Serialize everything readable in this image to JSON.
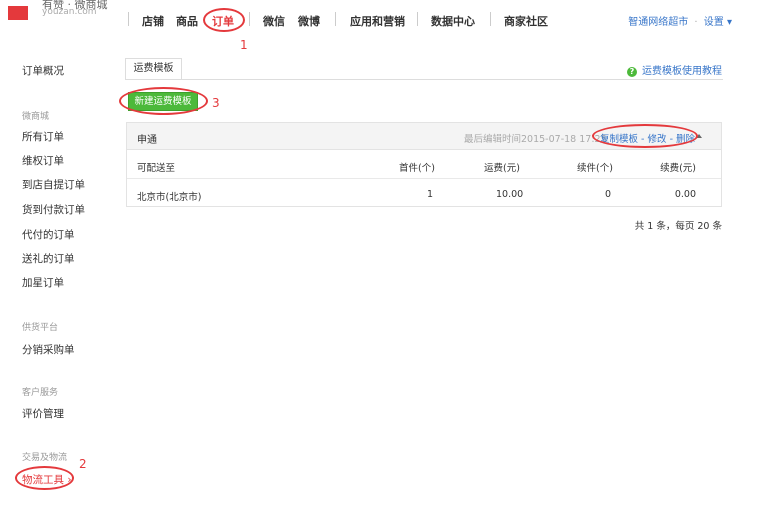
{
  "brand": {
    "title": "有赞 · 微商城",
    "subtitle": "youzan.com"
  },
  "nav": {
    "items": [
      "店铺",
      "商品",
      "订单",
      "微信",
      "微博",
      "应用和营销",
      "数据中心",
      "商家社区"
    ],
    "active": "订单"
  },
  "top_right": {
    "store": "智通网络超市",
    "sep": "·",
    "settings": "设置 ▾"
  },
  "sidebar": {
    "overview": "订单概况",
    "group_weishop": "微商城",
    "orders": [
      "所有订单",
      "维权订单",
      "到店自提订单",
      "货到付款订单",
      "代付的订单",
      "送礼的订单",
      "加星订单"
    ],
    "group_supply": "供货平台",
    "supply_items": [
      "分销采购单"
    ],
    "group_service": "客户服务",
    "service_items": [
      "评价管理"
    ],
    "group_logistics": "交易及物流",
    "logistics_items": [
      "物流工具 ›"
    ]
  },
  "main": {
    "tab": "运费模板",
    "help_link": "运费模板使用教程",
    "new_button": "新建运费模板",
    "template": {
      "name": "申通",
      "last_edit": "最后编辑时间2015-07-18 17:25",
      "actions": {
        "copy": "复制模板",
        "dash": "-",
        "edit": "修改",
        "delete": "删除"
      },
      "headers": {
        "region": "可配送至",
        "first_qty": "首件(个)",
        "first_fee": "运费(元)",
        "more_qty": "续件(个)",
        "more_fee": "续费(元)"
      },
      "rows": [
        {
          "region": "北京市(北京市)",
          "first_qty": "1",
          "first_fee": "10.00",
          "more_qty": "0",
          "more_fee": "0.00"
        }
      ]
    },
    "pager": "共 1 条，每页 20 条"
  },
  "annotations": {
    "a1": "1",
    "a2": "2",
    "a3": "3"
  },
  "colors": {
    "accent_red": "#e4393c",
    "link_blue": "#3876c9",
    "button_green": "#4cb93a"
  }
}
